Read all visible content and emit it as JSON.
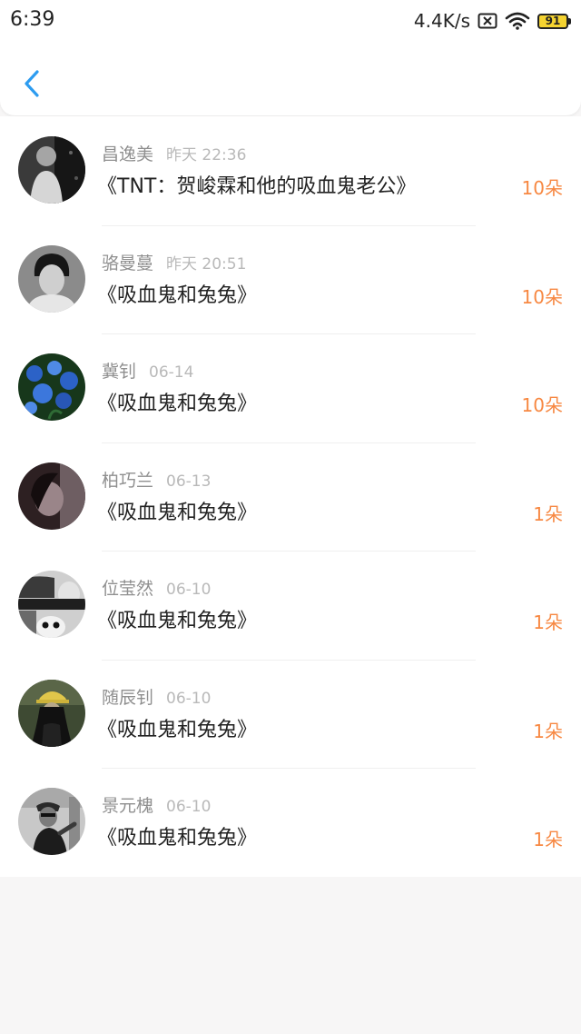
{
  "status_bar": {
    "time": "6:39",
    "net_speed": "4.4K/s",
    "battery_level": "91",
    "icons": [
      "sim-x-icon",
      "wifi-icon",
      "battery-icon"
    ]
  },
  "nav": {
    "back_icon": "back-arrow-icon",
    "accent_color": "#2d9cf0"
  },
  "colors": {
    "count_color": "#f78842",
    "name_color": "#8f8f8f",
    "time_color": "#b9b9b9",
    "title_color": "#222222"
  },
  "items": [
    {
      "name": "昌逸美",
      "time": "昨天 22:36",
      "title": "《TNT：贺峻霖和他的吸血鬼老公》",
      "count": "10朵"
    },
    {
      "name": "骆曼蔓",
      "time": "昨天 20:51",
      "title": "《吸血鬼和兔兔》",
      "count": "10朵"
    },
    {
      "name": "冀钊",
      "time": "06-14",
      "title": "《吸血鬼和兔兔》",
      "count": "10朵"
    },
    {
      "name": "柏巧兰",
      "time": "06-13",
      "title": "《吸血鬼和兔兔》",
      "count": "1朵"
    },
    {
      "name": "位莹然",
      "time": "06-10",
      "title": "《吸血鬼和兔兔》",
      "count": "1朵"
    },
    {
      "name": "随辰钊",
      "time": "06-10",
      "title": "《吸血鬼和兔兔》",
      "count": "1朵"
    },
    {
      "name": "景元槐",
      "time": "06-10",
      "title": "《吸血鬼和兔兔》",
      "count": "1朵"
    }
  ]
}
